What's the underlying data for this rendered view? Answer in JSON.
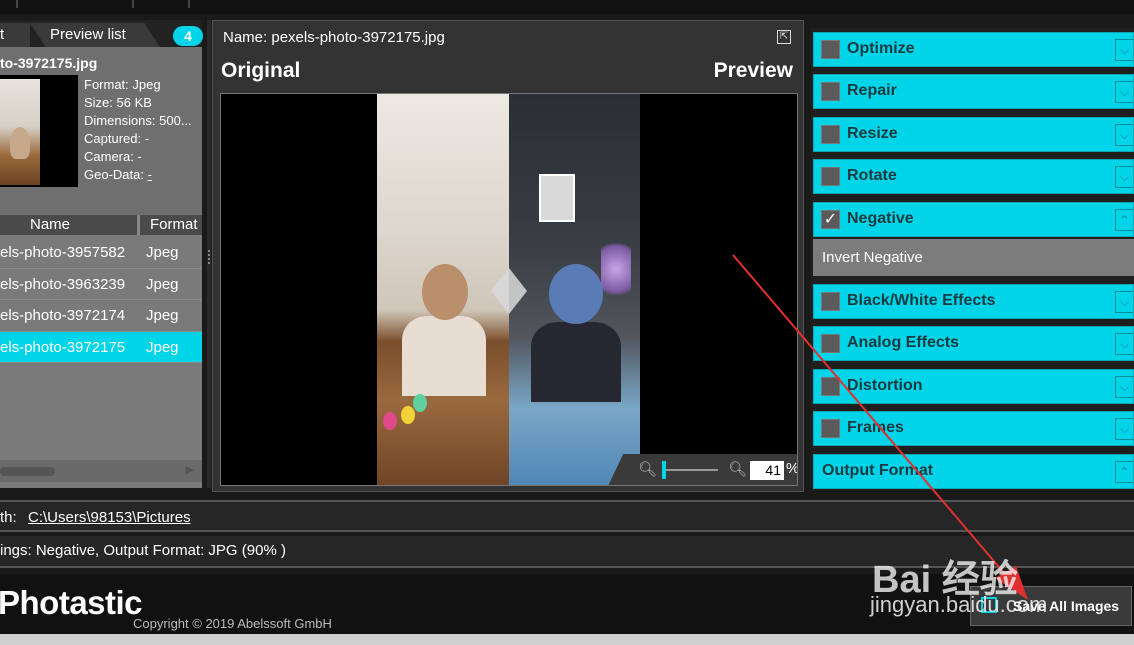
{
  "tabs": {
    "left_tab_label": "t",
    "preview_tab_label": "Preview list",
    "count": "4"
  },
  "info": {
    "filename": "to-3972175.jpg",
    "format": "Format: Jpeg",
    "size": "Size: 56 KB",
    "dimensions": "Dimensions: 500...",
    "captured": "Captured: -",
    "camera": "Camera: -",
    "geo_label": "Geo-Data: ",
    "geo_link": "-"
  },
  "list": {
    "col_name": "Name",
    "col_format": "Format",
    "rows": [
      {
        "name": "els-photo-3957582",
        "format": "Jpeg"
      },
      {
        "name": "els-photo-3963239",
        "format": "Jpeg"
      },
      {
        "name": "els-photo-3972174",
        "format": "Jpeg"
      },
      {
        "name": "els-photo-3972175",
        "format": "Jpeg"
      }
    ],
    "selected_index": 3
  },
  "viewer": {
    "name_label": "Name: pexels-photo-3972175.jpg",
    "original_label": "Original",
    "preview_label": "Preview",
    "zoom_value": "41",
    "zoom_unit": "%"
  },
  "effects": [
    {
      "label": "Optimize",
      "checked": false
    },
    {
      "label": "Repair",
      "checked": false
    },
    {
      "label": "Resize",
      "checked": false
    },
    {
      "label": "Rotate",
      "checked": false
    },
    {
      "label": "Negative",
      "checked": true
    },
    {
      "label": "Black/White Effects",
      "checked": false
    },
    {
      "label": "Analog Effects",
      "checked": false
    },
    {
      "label": "Distortion",
      "checked": false
    },
    {
      "label": "Frames",
      "checked": false
    }
  ],
  "negative_sub_item": "Invert Negative",
  "output_format_label": "Output Format",
  "path": {
    "label": "th:",
    "value": "C:\\Users\\98153\\Pictures"
  },
  "settings_text": "ings: Negative, Output Format: JPG (90% )",
  "footer": {
    "logo": "Photastic",
    "copyright": "Copyright © 2019 Abelssoft GmbH",
    "save_all_label": "Save All Images"
  },
  "watermark": {
    "line1": "Bai 经验",
    "line2": "jingyan.baidu.com"
  },
  "colors": {
    "accent": "#00d4e8",
    "annotation_arrow": "#e03030"
  }
}
